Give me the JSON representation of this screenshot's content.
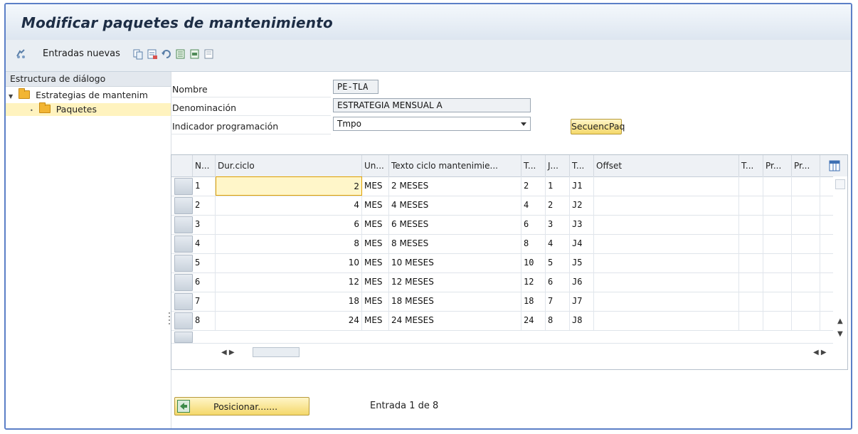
{
  "window": {
    "title": "Modificar paquetes de mantenimiento"
  },
  "toolbar": {
    "new_entries_label": "Entradas nuevas",
    "icons": [
      "glasses-icon",
      "copy-icon",
      "delete-icon",
      "undo-icon",
      "select-all-icon",
      "select-block-icon",
      "deselect-icon"
    ]
  },
  "tree": {
    "header": "Estructura de diálogo",
    "items": [
      {
        "label": "Estrategias de mantenim",
        "level": 0,
        "expanded": true
      },
      {
        "label": "Paquetes",
        "level": 1,
        "selected": true
      }
    ]
  },
  "form": {
    "nombre_label": "Nombre",
    "nombre_value": "PE-TLA",
    "denominacion_label": "Denominación",
    "denominacion_value": "ESTRATEGIA MENSUAL A",
    "indicador_label": "Indicador programación",
    "indicador_value": "Tmpo",
    "secuencia_button": "SecuencPaq"
  },
  "table": {
    "headers": [
      "N...",
      "Dur.ciclo",
      "Un...",
      "Texto ciclo mantenimie...",
      "T...",
      "J...",
      "T...",
      "Offset",
      "T...",
      "Pr...",
      "Pr..."
    ],
    "rows": [
      {
        "n": "1",
        "dur": "2",
        "un": "MES",
        "texto": "2 MESES",
        "t1": "2",
        "j": "1",
        "t2": "J1"
      },
      {
        "n": "2",
        "dur": "4",
        "un": "MES",
        "texto": "4 MESES",
        "t1": "4",
        "j": "2",
        "t2": "J2"
      },
      {
        "n": "3",
        "dur": "6",
        "un": "MES",
        "texto": "6 MESES",
        "t1": "6",
        "j": "3",
        "t2": "J3"
      },
      {
        "n": "4",
        "dur": "8",
        "un": "MES",
        "texto": "8 MESES",
        "t1": "8",
        "j": "4",
        "t2": "J4"
      },
      {
        "n": "5",
        "dur": "10",
        "un": "MES",
        "texto": "10 MESES",
        "t1": "10",
        "j": "5",
        "t2": "J5"
      },
      {
        "n": "6",
        "dur": "12",
        "un": "MES",
        "texto": "12 MESES",
        "t1": "12",
        "j": "6",
        "t2": "J6"
      },
      {
        "n": "7",
        "dur": "18",
        "un": "MES",
        "texto": "18 MESES",
        "t1": "18",
        "j": "7",
        "t2": "J7"
      },
      {
        "n": "8",
        "dur": "24",
        "un": "MES",
        "texto": "24 MESES",
        "t1": "24",
        "j": "8",
        "t2": "J8"
      }
    ]
  },
  "footer": {
    "position_button": "Posicionar.......",
    "entry_status": "Entrada 1 de 8"
  },
  "colors": {
    "title_text": "#1d2d45",
    "selection_yellow": "#fff3bf",
    "button_yellow": "#f4d86a",
    "frame_border": "#5b7fc7"
  }
}
